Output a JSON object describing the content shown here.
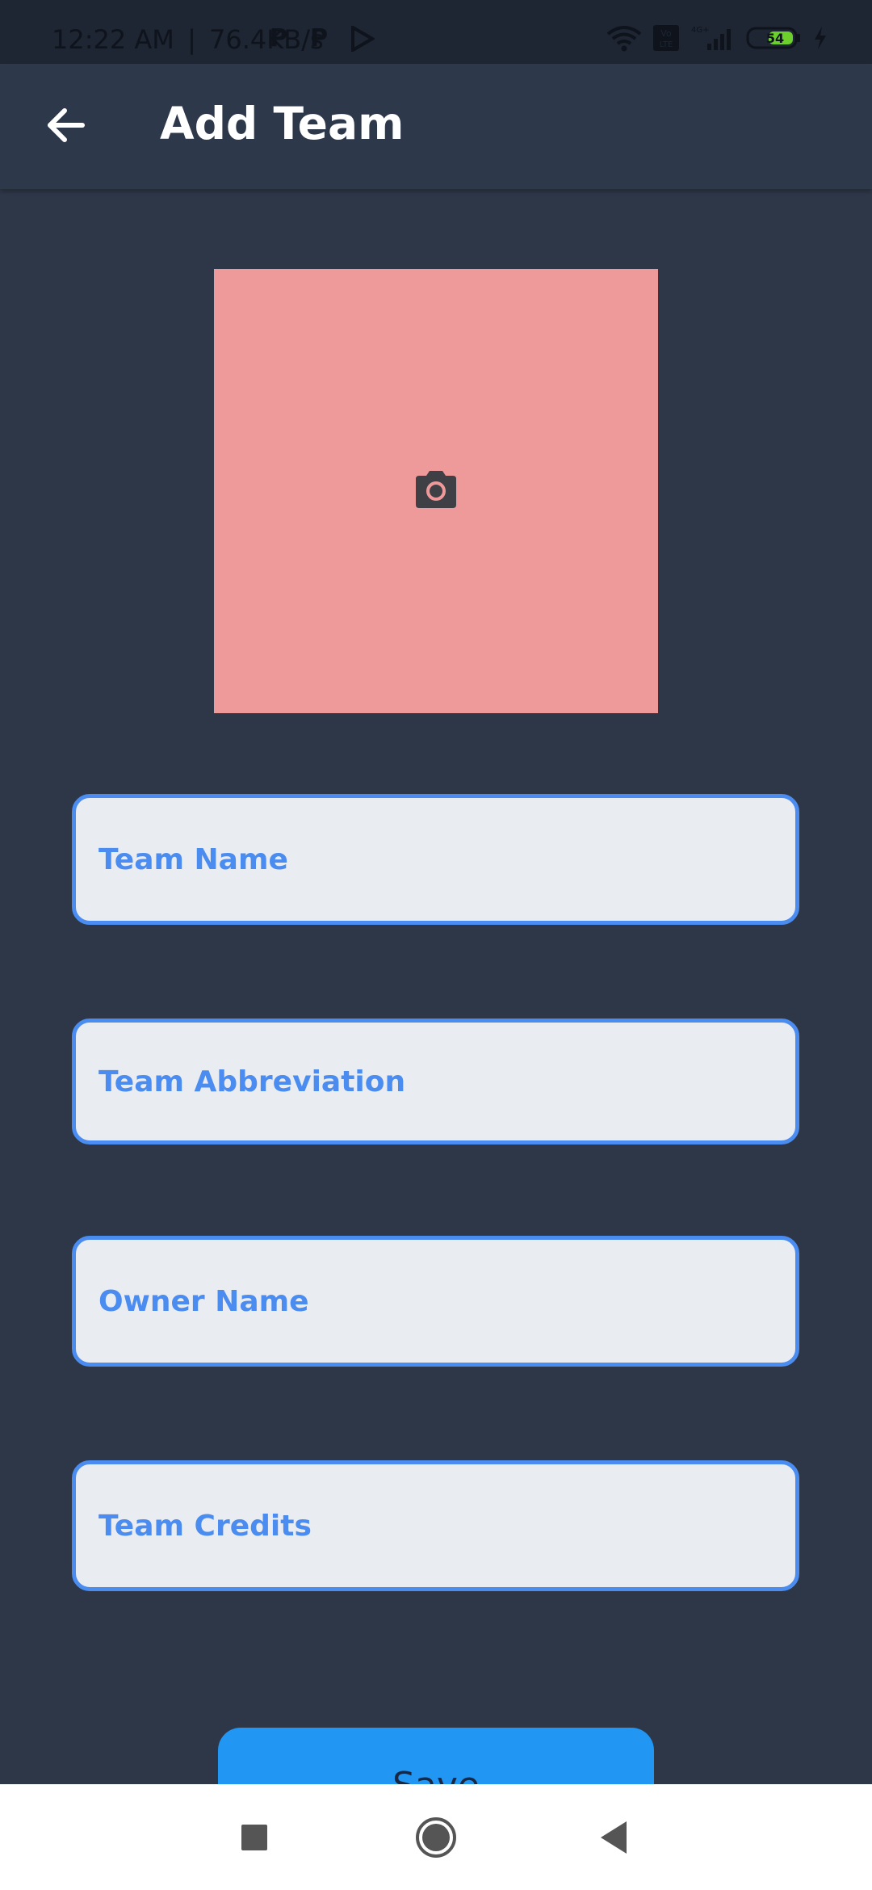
{
  "status_bar": {
    "time": "12:22 AM",
    "separator": "|",
    "speed": "76.4KB/s",
    "apps": [
      "P",
      "P"
    ],
    "battery": "54",
    "network_label": "4G+",
    "volte_label": "Vo LTE"
  },
  "app_bar": {
    "title": "Add Team",
    "back_icon": "arrow-left-icon"
  },
  "image_picker": {
    "icon": "camera-icon",
    "background": "#ef9a9a"
  },
  "form": {
    "team_name": {
      "placeholder": "Team Name",
      "value": ""
    },
    "team_abbreviation": {
      "placeholder": "Team Abbreviation",
      "value": ""
    },
    "owner_name": {
      "placeholder": "Owner Name",
      "value": ""
    },
    "team_credits": {
      "placeholder": "Team Credits",
      "value": ""
    }
  },
  "save_button": {
    "label": "Save"
  },
  "colors": {
    "background": "#2d3748",
    "accent": "#4a8cf0",
    "button": "#2196f3"
  }
}
